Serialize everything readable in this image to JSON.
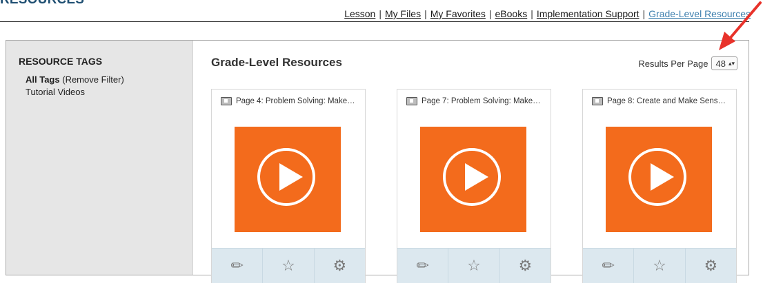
{
  "page": {
    "heading": "RESOURCES"
  },
  "topnav": {
    "items": [
      {
        "label": "Lesson"
      },
      {
        "label": "My Files"
      },
      {
        "label": "My Favorites"
      },
      {
        "label": "eBooks"
      },
      {
        "label": "Implementation Support"
      },
      {
        "label": "Grade-Level Resources"
      }
    ],
    "separator": "|",
    "active_color": "#3d7fae"
  },
  "sidebar": {
    "title": "RESOURCE TAGS",
    "all_tags": "All Tags",
    "remove_filter": "(Remove Filter)",
    "tag_1": "Tutorial Videos"
  },
  "main": {
    "title": "Grade-Level Resources",
    "results_per_page_label": "Results Per Page",
    "results_per_page_value": "48",
    "select_arrows": "▴▾"
  },
  "cards": [
    {
      "title": "Page 4: Problem Solving: Make…"
    },
    {
      "title": "Page 7: Problem Solving: Make…"
    },
    {
      "title": "Page 8: Create and Make Sens…"
    }
  ],
  "icons": {
    "edit": "pencil-icon",
    "favorite": "star-icon",
    "settings": "gear-icon",
    "video": "film-icon",
    "play": "play-icon"
  },
  "colors": {
    "thumb": "#f36b1c",
    "toolbar": "#dce8ef",
    "annotation_arrow": "#e8322a",
    "heading": "#1f4f72"
  }
}
